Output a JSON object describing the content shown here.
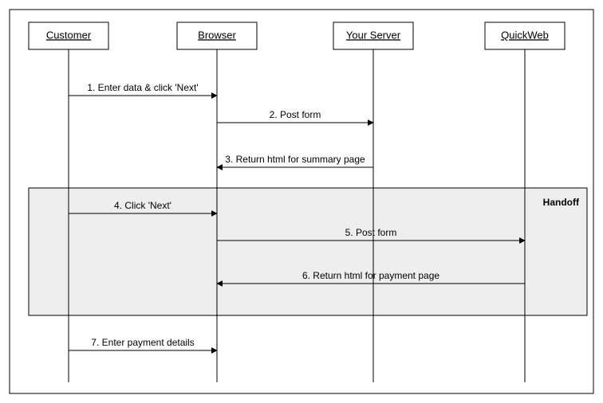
{
  "participants": {
    "customer": "Customer",
    "browser": "Browser",
    "server": "Your Server",
    "quickweb": "QuickWeb"
  },
  "messages": {
    "m1": "1. Enter data & click 'Next'",
    "m2": "2. Post form",
    "m3": "3. Return html for summary page",
    "m4": "4. Click 'Next'",
    "m5": "5. Post form",
    "m6": "6. Return html for payment page",
    "m7": "7. Enter payment details"
  },
  "fragment": {
    "label": "Handoff"
  }
}
